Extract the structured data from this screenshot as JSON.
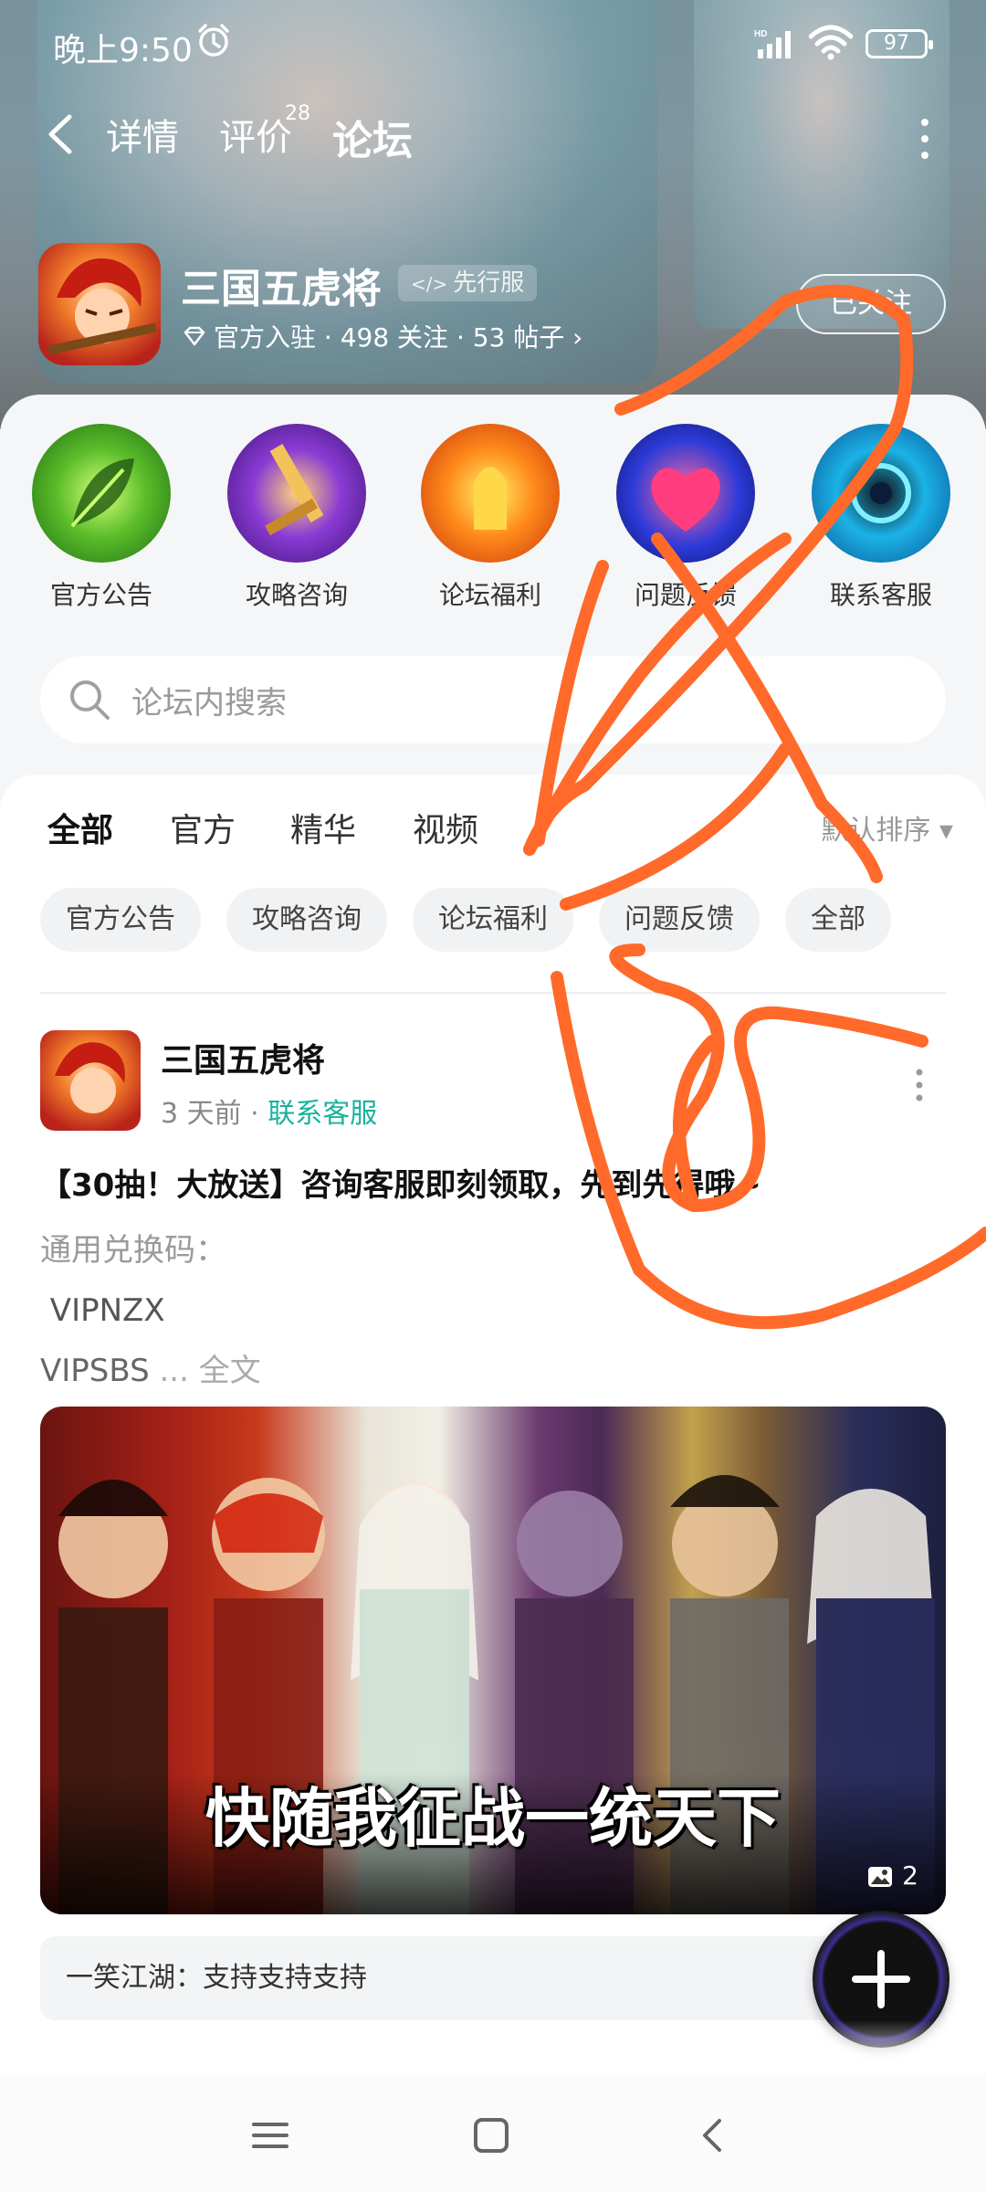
{
  "status_bar": {
    "time": "晚上9:50",
    "battery": "97",
    "signal_label": "HD"
  },
  "nav": {
    "tabs": [
      {
        "label": "详情"
      },
      {
        "label": "评价",
        "badge": "28"
      },
      {
        "label": "论坛"
      }
    ],
    "active": "论坛"
  },
  "game": {
    "title": "三国五虎将",
    "badge": "先行服",
    "meta": "官方入驻 · 498 关注 · 53 帖子 ›",
    "follow_label": "已关注"
  },
  "quick_links": [
    {
      "label": "官方公告",
      "icon": "leaf-icon"
    },
    {
      "label": "攻略咨询",
      "icon": "sword-icon"
    },
    {
      "label": "论坛福利",
      "icon": "gift-flame-icon"
    },
    {
      "label": "问题反馈",
      "icon": "heart-icon"
    },
    {
      "label": "联系客服",
      "icon": "orb-icon"
    }
  ],
  "search": {
    "placeholder": "论坛内搜索"
  },
  "filter_tabs": {
    "items": [
      "全部",
      "官方",
      "精华",
      "视频"
    ],
    "active": "全部",
    "sort_label": "默认排序 ▾"
  },
  "chips": [
    "官方公告",
    "攻略咨询",
    "论坛福利",
    "问题反馈",
    "全部"
  ],
  "post": {
    "author": "三国五虎将",
    "time": "3 天前",
    "separator": "·",
    "category": "联系客服",
    "title": "【30抽！大放送】咨询客服即刻领取，先到先得哦~",
    "body_lines": [
      "通用兑换码：",
      " VIPNZX",
      "VIPSBS"
    ],
    "read_more": " ... 全文",
    "image_caption": "快随我征战一统天下",
    "image_count": "2"
  },
  "comment": {
    "text": "一笑江湖：支持支持支持"
  },
  "colors": {
    "accent": "#19c9b0",
    "scribble": "#ff6a2a"
  }
}
